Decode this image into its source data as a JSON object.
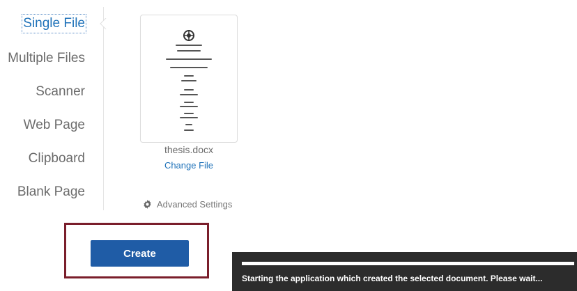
{
  "sources": [
    {
      "label": "Single File",
      "active": true
    },
    {
      "label": "Multiple Files",
      "active": false
    },
    {
      "label": "Scanner",
      "active": false
    },
    {
      "label": "Web Page",
      "active": false
    },
    {
      "label": "Clipboard",
      "active": false
    },
    {
      "label": "Blank Page",
      "active": false
    }
  ],
  "file": {
    "name": "thesis.docx",
    "change_label": "Change File"
  },
  "advanced_settings_label": "Advanced Settings",
  "create_label": "Create",
  "status": {
    "message": "Starting the application which created the selected document. Please wait..."
  },
  "colors": {
    "accent": "#1f72b9",
    "button": "#1f5ca6",
    "highlight": "#7a1e2b",
    "toast": "#2c2c2c"
  }
}
